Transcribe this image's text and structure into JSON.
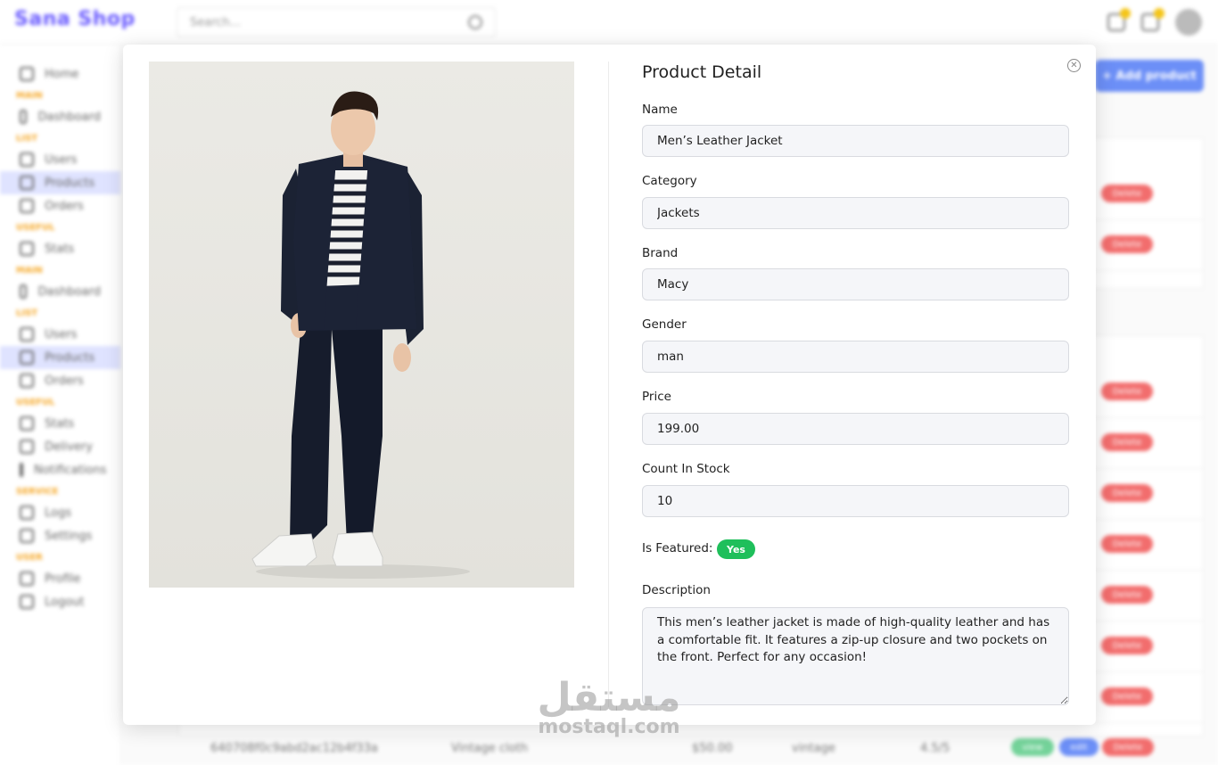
{
  "app": {
    "logo": "Sana Shop",
    "search_placeholder": "Search...",
    "add_product_label": "+ Add product"
  },
  "sidebar": [
    {
      "type": "item",
      "label": "Home",
      "icon": "home-icon"
    },
    {
      "type": "section",
      "label": "MAIN"
    },
    {
      "type": "item",
      "label": "Dashboard",
      "icon": "dashboard-icon"
    },
    {
      "type": "section",
      "label": "LIST"
    },
    {
      "type": "item",
      "label": "Users",
      "icon": "users-icon"
    },
    {
      "type": "item",
      "label": "Products",
      "icon": "products-icon",
      "active": true
    },
    {
      "type": "item",
      "label": "Orders",
      "icon": "orders-icon"
    },
    {
      "type": "section",
      "label": "USEFUL"
    },
    {
      "type": "item",
      "label": "Stats",
      "icon": "stats-icon"
    },
    {
      "type": "section",
      "label": "MAIN"
    },
    {
      "type": "item",
      "label": "Dashboard",
      "icon": "dashboard-icon"
    },
    {
      "type": "section",
      "label": "LIST"
    },
    {
      "type": "item",
      "label": "Users",
      "icon": "users-icon"
    },
    {
      "type": "item",
      "label": "Products",
      "icon": "products-icon",
      "active": true
    },
    {
      "type": "item",
      "label": "Orders",
      "icon": "orders-icon"
    },
    {
      "type": "section",
      "label": "USEFUL"
    },
    {
      "type": "item",
      "label": "Stats",
      "icon": "stats-icon"
    },
    {
      "type": "item",
      "label": "Delivery",
      "icon": "delivery-icon"
    },
    {
      "type": "item",
      "label": "Notifications",
      "icon": "notifications-icon"
    },
    {
      "type": "section",
      "label": "SERVICE"
    },
    {
      "type": "item",
      "label": "Logs",
      "icon": "logs-icon"
    },
    {
      "type": "item",
      "label": "Settings",
      "icon": "settings-icon"
    },
    {
      "type": "section",
      "label": "USER"
    },
    {
      "type": "item",
      "label": "Profile",
      "icon": "profile-icon"
    },
    {
      "type": "item",
      "label": "Logout",
      "icon": "logout-icon"
    }
  ],
  "table": {
    "delete_label": "Delete",
    "edit_label": "edit",
    "view_label": "view",
    "last_row": {
      "id": "640708f0c9abd2ac12b4f33a",
      "name": "Vintage cloth",
      "price": "$50.00",
      "category": "vintage",
      "rating": "4.5/5"
    }
  },
  "modal": {
    "title": "Product Detail",
    "image_alt": "Man wearing a dark jacket, striped shirt, dark trousers and white sneakers",
    "fields": {
      "name": {
        "label": "Name",
        "value": "Men’s Leather Jacket"
      },
      "category": {
        "label": "Category",
        "value": "Jackets"
      },
      "brand": {
        "label": "Brand",
        "value": "Macy"
      },
      "gender": {
        "label": "Gender",
        "value": "man"
      },
      "price": {
        "label": "Price",
        "value": "199.00"
      },
      "count_in_stock": {
        "label": "Count In Stock",
        "value": "10"
      }
    },
    "featured": {
      "label": "Is Featured:",
      "value": "Yes"
    },
    "description": {
      "label": "Description",
      "value": "This men’s leather jacket is made of high-quality leather and has a comfortable fit. It features a zip-up closure and two pockets on the front. Perfect for any occasion!"
    }
  },
  "watermark": {
    "arabic": "مستقل",
    "latin": "mostaql.com"
  },
  "colors": {
    "accent": "#6c8ff7",
    "featured_badge": "#1fbf5b",
    "delete": "#f26d6d",
    "section_heading": "#f5a623"
  }
}
